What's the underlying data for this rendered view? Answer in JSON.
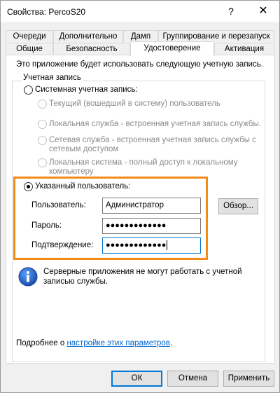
{
  "window": {
    "title": "Свойства: PercoS20",
    "help": "?",
    "close": "✕"
  },
  "tabs_back": [
    "Очереди",
    "Дополнительно",
    "Дамп",
    "Группирование и перезапуск"
  ],
  "tabs_front": [
    "Общие",
    "Безопасность",
    "Удостоверение",
    "Активация"
  ],
  "active_tab": "Удостоверение",
  "intro": "Это приложение будет использовать следующую учетную запись.",
  "account": {
    "group_label": "Учетная запись",
    "system_radio": "Системная учетная запись:",
    "system_options": [
      "Текущий (вошедший в систему) пользователь",
      "Локальная служба - встроенная учетная запись службы.",
      "Сетевая служба - встроенная учетная запись службы с",
      "сетевым доступом",
      "Локальная система - полный доступ к локальному",
      "компьютеру"
    ],
    "specified_radio": "Указанный пользователь:",
    "user_label": "Пользователь:",
    "user_value": "Администратор",
    "browse_button": "Обзор...",
    "password_label": "Пароль:",
    "password_value": "●●●●●●●●●●●●●",
    "confirm_label": "Подтверждение:",
    "confirm_value": "●●●●●●●●●●●●●"
  },
  "info": {
    "icon": "info-icon",
    "line1": "Серверные приложения не могут работать с учетной",
    "line2": "записью службы."
  },
  "more": {
    "prefix": "Подробнее о ",
    "link": "настройке этих параметров",
    "suffix": "."
  },
  "buttons": {
    "ok": "ОК",
    "cancel": "Отмена",
    "apply": "Применить"
  },
  "colors": {
    "highlight": "#f28c18",
    "link": "#0066cc",
    "focus": "#0078d7"
  }
}
